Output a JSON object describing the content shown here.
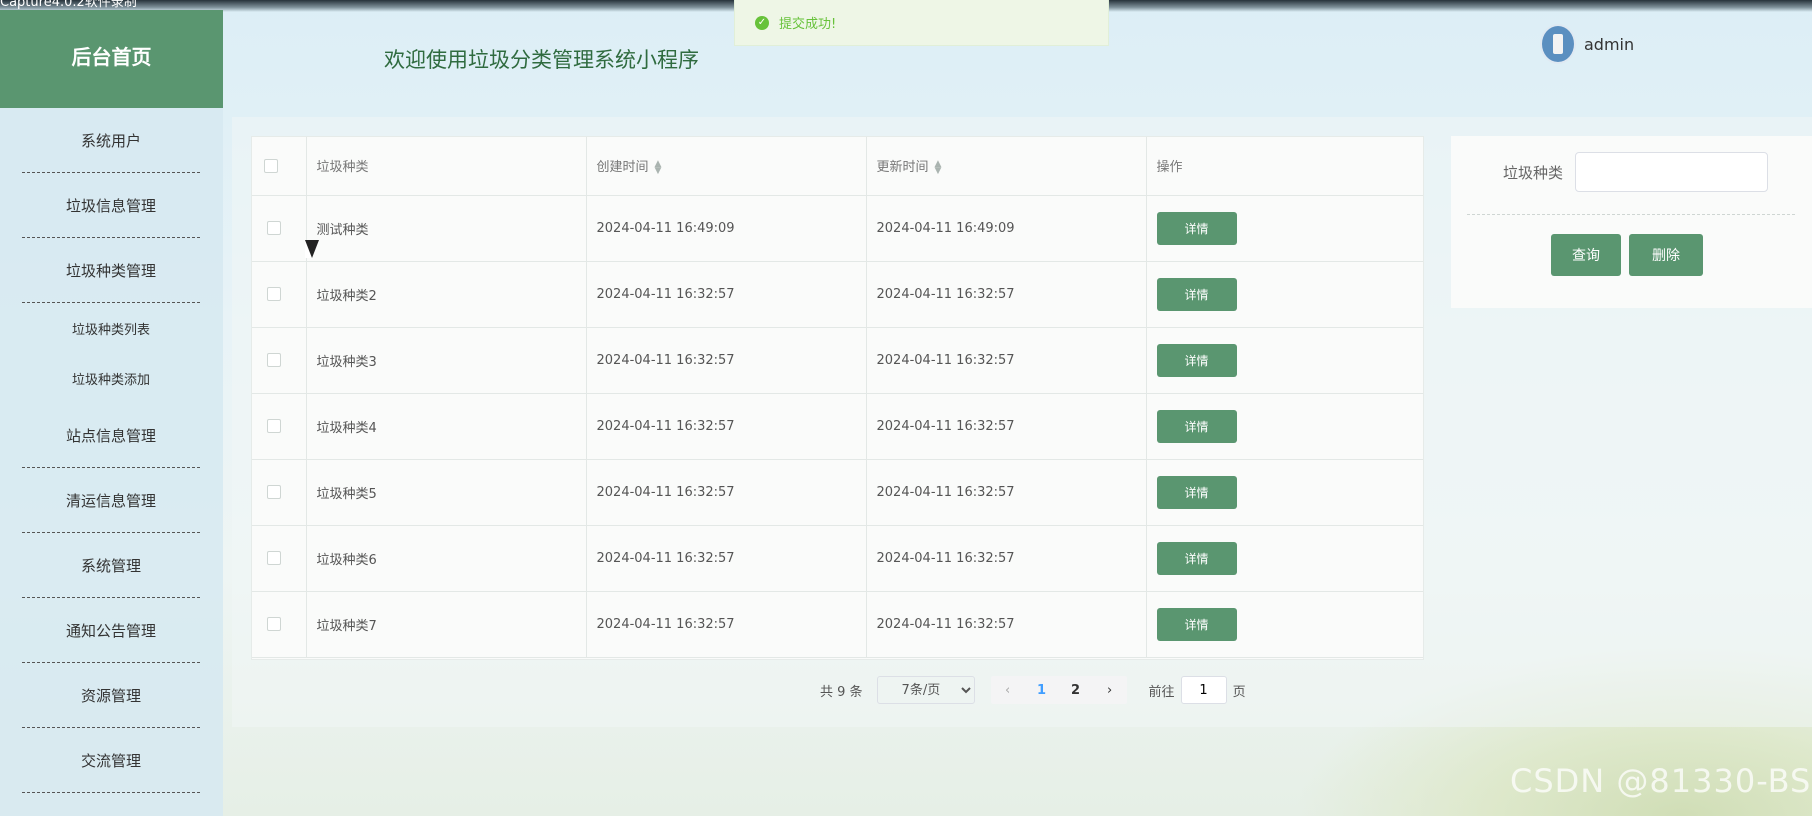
{
  "capture_title": "Capture4.0.2软件录制",
  "toast": {
    "text": "提交成功!"
  },
  "header": {
    "welcome": "欢迎使用垃圾分类管理系统小程序",
    "username": "admin"
  },
  "sidebar": {
    "brand": "后台首页",
    "items": [
      {
        "label": "系统用户"
      },
      {
        "label": "垃圾信息管理"
      },
      {
        "label": "垃圾种类管理",
        "children": [
          {
            "label": "垃圾种类列表"
          },
          {
            "label": "垃圾种类添加"
          }
        ]
      },
      {
        "label": "站点信息管理"
      },
      {
        "label": "清运信息管理"
      },
      {
        "label": "系统管理"
      },
      {
        "label": "通知公告管理"
      },
      {
        "label": "资源管理"
      },
      {
        "label": "交流管理"
      }
    ]
  },
  "table": {
    "columns": [
      "垃圾种类",
      "创建时间",
      "更新时间",
      "操作"
    ],
    "detail_label": "详情",
    "rows": [
      {
        "name": "测试种类",
        "created": "2024-04-11 16:49:09",
        "updated": "2024-04-11 16:49:09"
      },
      {
        "name": "垃圾种类2",
        "created": "2024-04-11 16:32:57",
        "updated": "2024-04-11 16:32:57"
      },
      {
        "name": "垃圾种类3",
        "created": "2024-04-11 16:32:57",
        "updated": "2024-04-11 16:32:57"
      },
      {
        "name": "垃圾种类4",
        "created": "2024-04-11 16:32:57",
        "updated": "2024-04-11 16:32:57"
      },
      {
        "name": "垃圾种类5",
        "created": "2024-04-11 16:32:57",
        "updated": "2024-04-11 16:32:57"
      },
      {
        "name": "垃圾种类6",
        "created": "2024-04-11 16:32:57",
        "updated": "2024-04-11 16:32:57"
      },
      {
        "name": "垃圾种类7",
        "created": "2024-04-11 16:32:57",
        "updated": "2024-04-11 16:32:57"
      }
    ]
  },
  "pagination": {
    "total": "共 9 条",
    "page_size": "7条/页",
    "pages": [
      "1",
      "2"
    ],
    "goto_label": "前往",
    "goto_value": "1",
    "page_suffix": "页"
  },
  "search": {
    "label": "垃圾种类",
    "value": "",
    "query_label": "查询",
    "delete_label": "删除"
  },
  "watermark": "CSDN @81330-BS"
}
